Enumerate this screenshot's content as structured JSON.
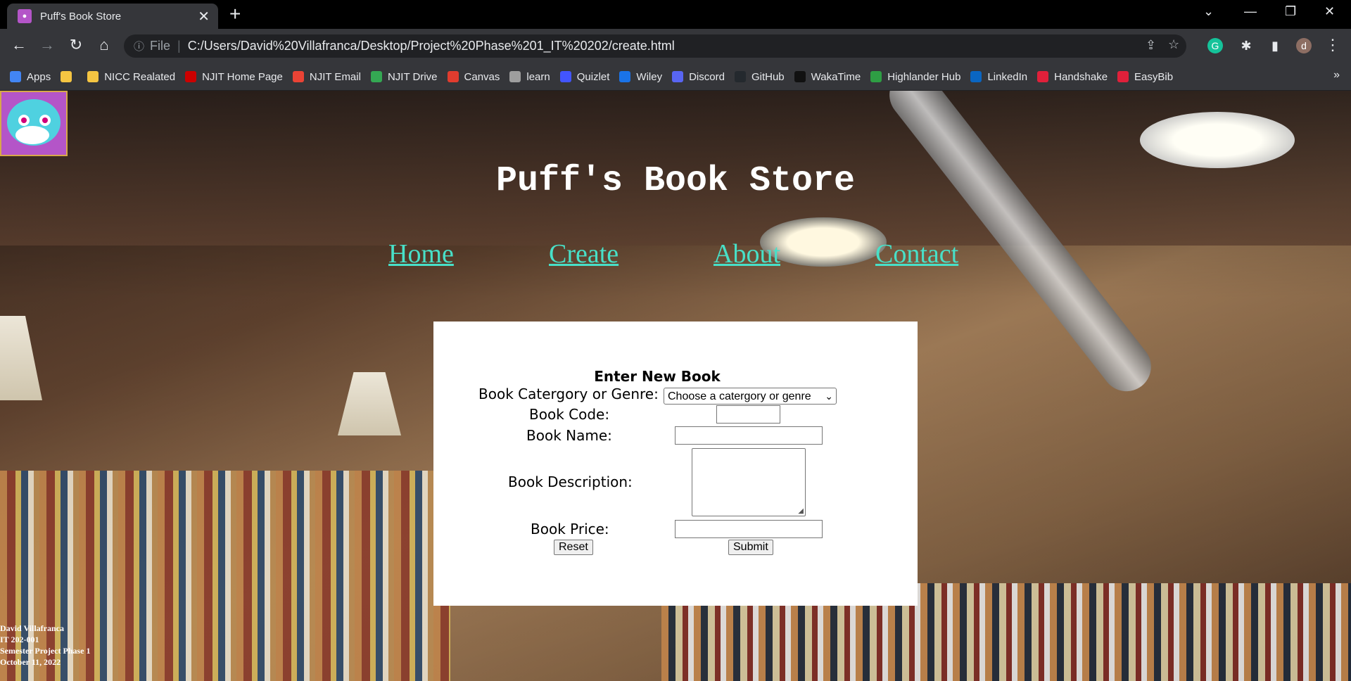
{
  "browser": {
    "tab_title": "Puff's Book Store",
    "url_scheme": "File",
    "url": "C:/Users/David%20Villafranca/Desktop/Project%20Phase%201_IT%20202/create.html",
    "profile_initial": "d"
  },
  "bookmarks": [
    {
      "label": "Apps",
      "icon": "apps-grid-icon",
      "color": "#4285f4"
    },
    {
      "label": "",
      "icon": "folder-icon",
      "color": "#f5c542"
    },
    {
      "label": "NICC Realated",
      "icon": "folder-icon",
      "color": "#f5c542"
    },
    {
      "label": "NJIT Home Page",
      "icon": "njit-icon",
      "color": "#cc0000"
    },
    {
      "label": "NJIT Email",
      "icon": "gmail-icon",
      "color": "#ea4335"
    },
    {
      "label": "NJIT Drive",
      "icon": "drive-icon",
      "color": "#34a853"
    },
    {
      "label": "Canvas",
      "icon": "canvas-icon",
      "color": "#e13c2e"
    },
    {
      "label": "learn",
      "icon": "learn-icon",
      "color": "#9e9e9e"
    },
    {
      "label": "Quizlet",
      "icon": "quizlet-icon",
      "color": "#4255ff"
    },
    {
      "label": "Wiley",
      "icon": "wiley-icon",
      "color": "#1a73e8"
    },
    {
      "label": "Discord",
      "icon": "discord-icon",
      "color": "#5865f2"
    },
    {
      "label": "GitHub",
      "icon": "github-icon",
      "color": "#24292e"
    },
    {
      "label": "WakaTime",
      "icon": "wakatime-icon",
      "color": "#111111"
    },
    {
      "label": "Highlander Hub",
      "icon": "highlander-hub-icon",
      "color": "#2e9e44"
    },
    {
      "label": "LinkedIn",
      "icon": "linkedin-icon",
      "color": "#0a66c2"
    },
    {
      "label": "Handshake",
      "icon": "handshake-icon",
      "color": "#e0203a"
    },
    {
      "label": "EasyBib",
      "icon": "easybib-icon",
      "color": "#e0203a"
    }
  ],
  "site": {
    "title": "Puff's Book Store",
    "nav": [
      "Home",
      "Create",
      "About",
      "Contact"
    ],
    "nav_color": "#48e0c8"
  },
  "form": {
    "heading": "Enter New Book",
    "category_label": "Book Catergory or Genre:",
    "category_selected": "Choose a catergory or genre",
    "code_label": "Book Code:",
    "name_label": "Book Name:",
    "description_label": "Book Description:",
    "price_label": "Book Price:",
    "reset_label": "Reset",
    "submit_label": "Submit"
  },
  "footer": {
    "lines": [
      "David Villafranca",
      "IT 202-001",
      "Semester Project Phase 1",
      "October 11, 2022"
    ]
  }
}
